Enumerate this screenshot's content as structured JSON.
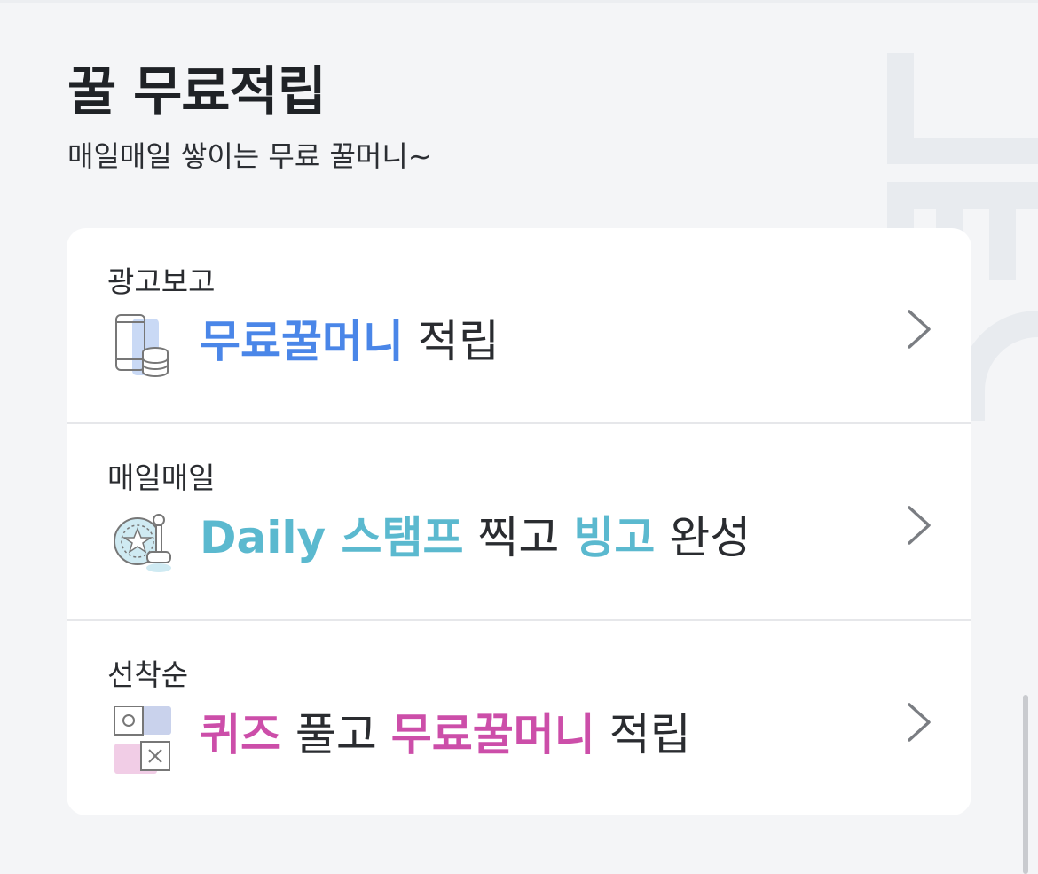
{
  "header": {
    "title": "꿀 무료적립",
    "subtitle": "매일매일 쌓이는 무료 꿀머니~"
  },
  "items": [
    {
      "label": "광고보고",
      "icon": "phone-coins-icon",
      "parts": [
        {
          "text": "무료꿀머니",
          "highlight": true
        },
        {
          "text": " 적립",
          "highlight": false
        }
      ],
      "accent": "#4a86e8"
    },
    {
      "label": "매일매일",
      "icon": "stamp-icon",
      "parts": [
        {
          "text": "Daily 스탬프",
          "highlight": true
        },
        {
          "text": " 찍고 ",
          "highlight": false
        },
        {
          "text": "빙고",
          "highlight": true
        },
        {
          "text": " 완성",
          "highlight": false
        }
      ],
      "accent": "#5bb9cf"
    },
    {
      "label": "선착순",
      "icon": "quiz-cards-icon",
      "parts": [
        {
          "text": "퀴즈",
          "highlight": true
        },
        {
          "text": " 풀고 ",
          "highlight": false
        },
        {
          "text": "무료꿀머니",
          "highlight": true
        },
        {
          "text": " 적립",
          "highlight": false
        }
      ],
      "accent": "#cc4ea9"
    }
  ]
}
